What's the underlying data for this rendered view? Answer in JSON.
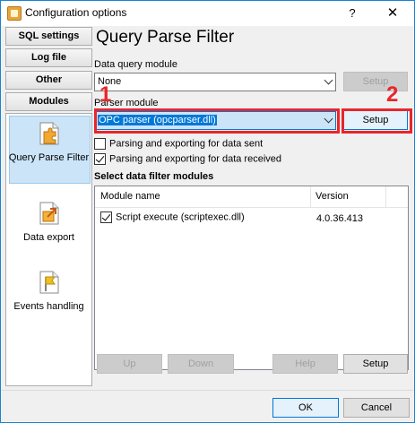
{
  "window": {
    "title": "Configuration options",
    "help_glyph": "?",
    "close_glyph": "✕"
  },
  "sidebar": {
    "tabs": [
      {
        "label": "SQL settings"
      },
      {
        "label": "Log file"
      },
      {
        "label": "Other"
      },
      {
        "label": "Modules"
      }
    ],
    "items": [
      {
        "label": "Query Parse Filter",
        "icon": "puzzle-icon",
        "selected": true
      },
      {
        "label": "Data export",
        "icon": "export-icon",
        "selected": false
      },
      {
        "label": "Events handling",
        "icon": "flag-icon",
        "selected": false
      }
    ]
  },
  "page": {
    "title": "Query Parse Filter",
    "data_query_module": {
      "label": "Data query module",
      "value": "None",
      "setup_label": "Setup"
    },
    "parser_module": {
      "label": "Parser module",
      "value": "OPC parser (opcparser.dll)",
      "setup_label": "Setup"
    },
    "checkboxes": [
      {
        "label": "Parsing and exporting for data sent",
        "checked": false
      },
      {
        "label": "Parsing and exporting for data received",
        "checked": true
      }
    ],
    "filter_section": {
      "title": "Select data filter modules",
      "columns": [
        "Module name",
        "Version"
      ],
      "rows": [
        {
          "name": "Script execute (scriptexec.dll)",
          "version": "4.0.36.413",
          "checked": true
        }
      ]
    },
    "buttons": {
      "up": "Up",
      "down": "Down",
      "help": "Help",
      "setup": "Setup"
    }
  },
  "footer": {
    "ok": "OK",
    "cancel": "Cancel"
  },
  "annotations": [
    {
      "number": "1"
    },
    {
      "number": "2"
    }
  ],
  "colors": {
    "annotation": "#e8262b",
    "selection": "#cce4f7",
    "accent": "#0078d7"
  }
}
